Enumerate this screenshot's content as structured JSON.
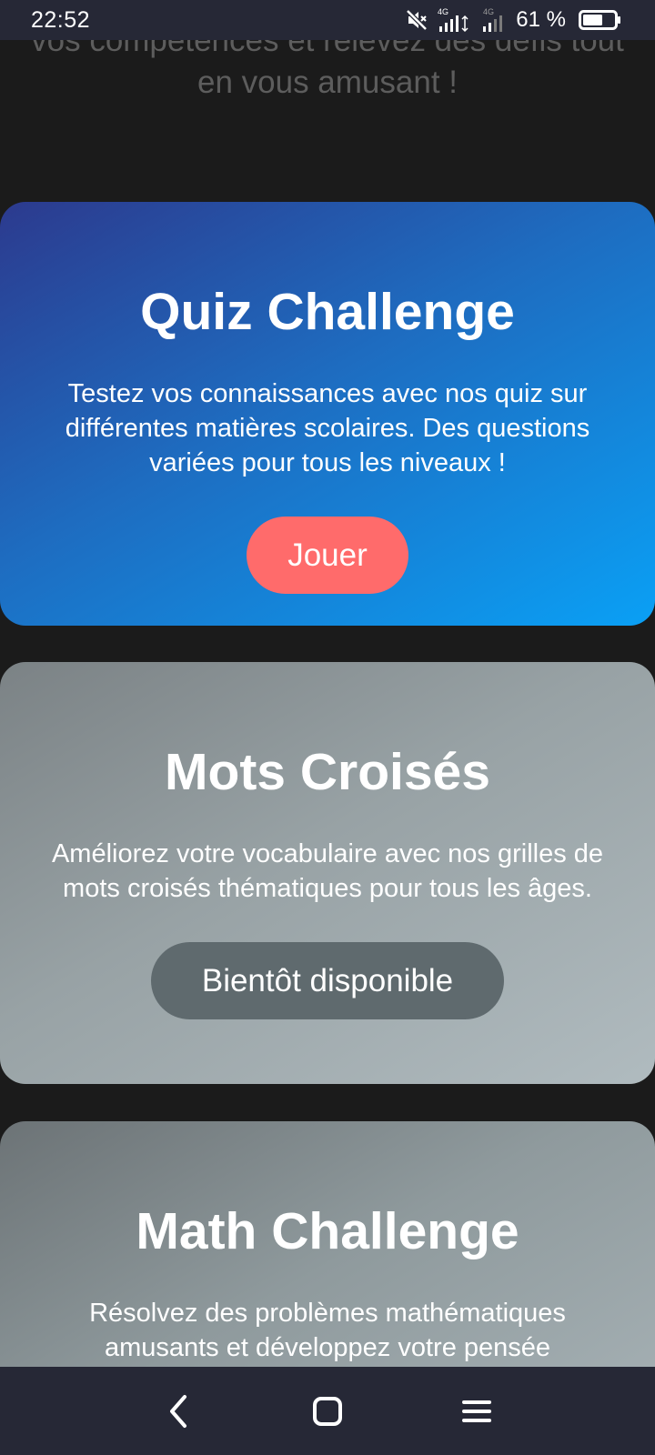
{
  "status_bar": {
    "time": "22:52",
    "network_1": "4G",
    "network_2": "4G",
    "battery_percent": "61 %",
    "battery_level": 0.61,
    "icons": [
      "mute-icon",
      "signal-icon",
      "battery-icon"
    ]
  },
  "intro": {
    "line1": "vos compétences et relevez des défis tout",
    "line2": "en vous amusant !"
  },
  "cards": [
    {
      "title": "Quiz Challenge",
      "description": "Testez vos connaissances avec nos quiz sur différentes matières scolaires. Des questions variées pour tous les niveaux !",
      "button": "Jouer",
      "button_color": "#ff6b6b"
    },
    {
      "title": "Mots Croisés",
      "description": "Améliorez votre vocabulaire avec nos grilles de mots croisés thématiques pour tous les âges.",
      "button": "Bientôt disponible",
      "button_color": "#5f6a6e"
    },
    {
      "title": "Math Challenge",
      "description": "Résolvez des problèmes mathématiques amusants et développez votre pensée"
    }
  ],
  "nav_bar": {
    "icons": [
      "back-icon",
      "home-icon",
      "menu-icon"
    ]
  }
}
